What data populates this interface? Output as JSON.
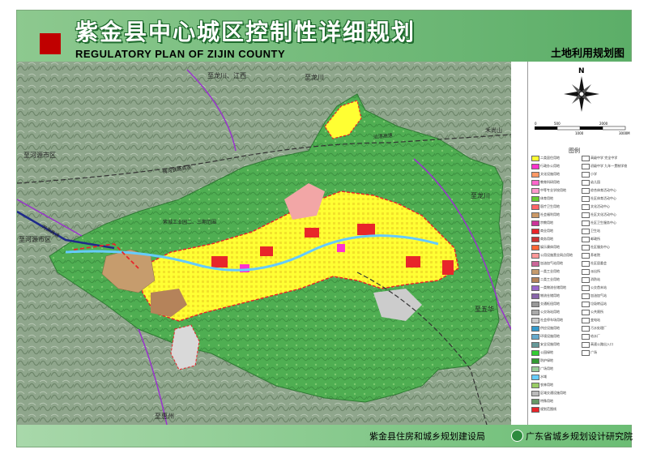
{
  "header": {
    "title_cn": "紫金县中心城区控制性详细规划",
    "title_en": "REGULATORY PLAN OF ZIJIN COUNTY",
    "map_type": "土地利用规划图"
  },
  "footer": {
    "left_org": "紫金县住房和城乡规划建设局",
    "right_org": "广东省城乡规划设计研究院"
  },
  "colors": {
    "header_green": "#5cae68",
    "terrain_green": "#5bb85a",
    "residential": "#ffff33",
    "commercial": "#e8252a",
    "industrial": "#b5835a",
    "admin": "#ff33cc",
    "boundary": "#e8252a"
  },
  "map": {
    "compass_letter": "N",
    "scale_labels": [
      "0",
      "500",
      "1000",
      "2000",
      "3000M"
    ],
    "place_labels": {
      "top_left": "至龙川、江西",
      "top_center": "至龙川",
      "right_upper": "至龙川",
      "left_upper": "至河源市区",
      "left_middle": "至河源市区",
      "right_lower": "至五华",
      "bottom_left": "至惠州",
      "top_right": "禾尚山"
    },
    "road_labels": [
      "河源高速",
      "梅河铁路高速",
      "梅河高速",
      "汕湛高速",
      "高速公路出入口"
    ],
    "district_labels": [
      "紫城工业园二、三期范围"
    ],
    "icons": [
      "compass-icon",
      "scale-bar"
    ]
  },
  "legend": {
    "title": "图例",
    "items": [
      {
        "label": "二类居住用地",
        "color": "#ffff33"
      },
      {
        "label": "行政办公用地",
        "color": "#ff33cc"
      },
      {
        "label": "文化设施用地",
        "color": "#ff9966"
      },
      {
        "label": "教育科研用地",
        "color": "#ff66cc"
      },
      {
        "label": "中等专业学校用地",
        "color": "#ff99cc"
      },
      {
        "label": "体育用地",
        "color": "#66cc33"
      },
      {
        "label": "医疗卫生用地",
        "color": "#ff6666"
      },
      {
        "label": "社会福利用地",
        "color": "#cc9966"
      },
      {
        "label": "宗教用地",
        "color": "#cc3399"
      },
      {
        "label": "商业用地",
        "color": "#e8252a"
      },
      {
        "label": "商务用地",
        "color": "#cc3333"
      },
      {
        "label": "娱乐康体用地",
        "color": "#ff6633"
      },
      {
        "label": "公用设施营业网点用地",
        "color": "#ff9999"
      },
      {
        "label": "加油加气站用地",
        "color": "#cc6699"
      },
      {
        "label": "一类工业用地",
        "color": "#c69c6d"
      },
      {
        "label": "二类工业用地",
        "color": "#b5835a"
      },
      {
        "label": "一类物流仓储用地",
        "color": "#9966cc"
      },
      {
        "label": "物流仓储用地",
        "color": "#8866aa"
      },
      {
        "label": "交通枢纽用地",
        "color": "#999999"
      },
      {
        "label": "公交场站用地",
        "color": "#aaaaaa"
      },
      {
        "label": "社会停车场用地",
        "color": "#cccccc"
      },
      {
        "label": "供应设施用地",
        "color": "#3399cc"
      },
      {
        "label": "环境设施用地",
        "color": "#66aacc"
      },
      {
        "label": "安全设施用地",
        "color": "#669999"
      },
      {
        "label": "公园绿地",
        "color": "#33cc33"
      },
      {
        "label": "防护绿地",
        "color": "#339933"
      },
      {
        "label": "广场用地",
        "color": "#99cc99"
      },
      {
        "label": "水域",
        "color": "#66ccff"
      },
      {
        "label": "农林用地",
        "color": "#99cc66"
      },
      {
        "label": "区域交通设施用地",
        "color": "#bbbbbb"
      },
      {
        "label": "特殊用地",
        "color": "#669966"
      },
      {
        "label": "规划范围线",
        "color": "#e8252a"
      }
    ],
    "legend_right": [
      "高级中学 完全中学",
      "初级中学 九年一贯制学校",
      "小学",
      "幼儿园",
      "综合体育活动中心",
      "社区体育活动中心",
      "文化活动中心",
      "社区文化活动中心",
      "社区卫生服务中心",
      "卫生站",
      "邮政所",
      "社区服务中心",
      "养老院",
      "社区居委会",
      "派出所",
      "消防站",
      "公交首末站",
      "加油加气站",
      "垃圾转运站",
      "公共厕所",
      "变电站",
      "污水处理厂",
      "给水厂",
      "高速公路出入口",
      "广场"
    ]
  }
}
